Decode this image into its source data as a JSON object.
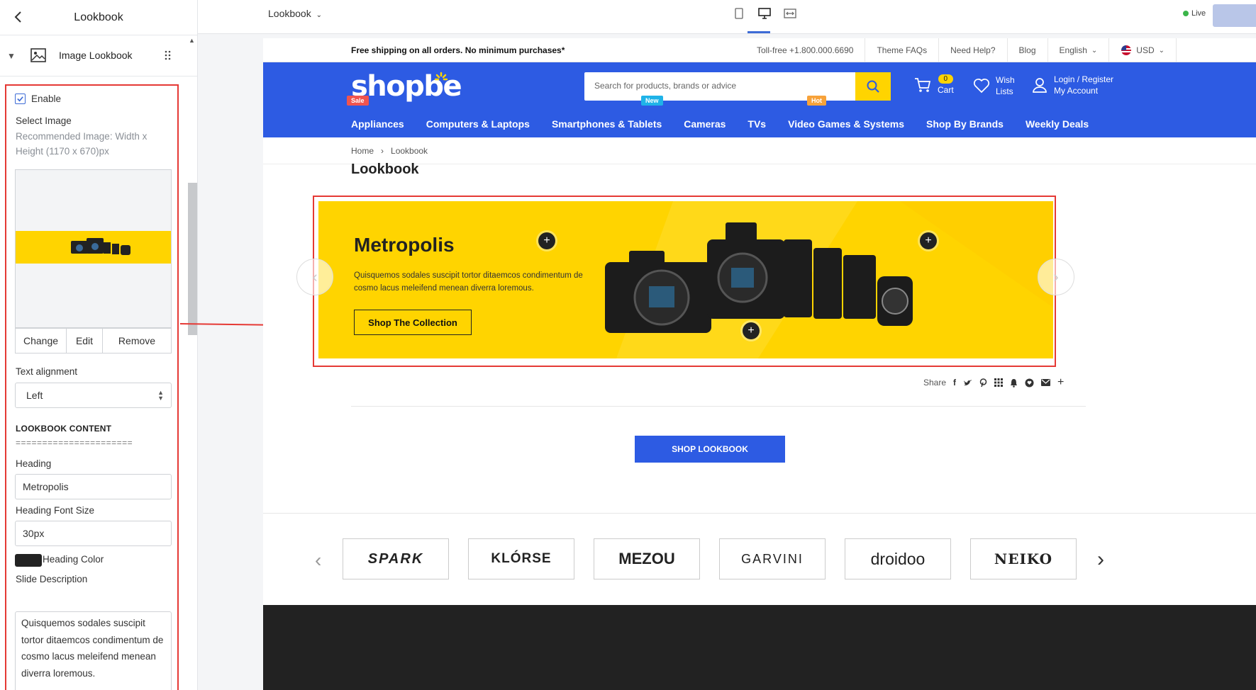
{
  "editor": {
    "title": "Lookbook",
    "block_label": "Image Lookbook",
    "enable_label": "Enable",
    "enable_checked": true,
    "select_image_label": "Select Image",
    "recommended_line1": "Recommended Image: Width x",
    "recommended_line2": "Height (1170 x 670)px",
    "image_buttons": [
      "Change",
      "Edit",
      "Remove"
    ],
    "text_alignment_label": "Text alignment",
    "text_alignment_value": "Left",
    "section_title": "LOOKBOOK CONTENT",
    "separator": "======================",
    "heading_label": "Heading",
    "heading_value": "Metropolis",
    "heading_font_size_label": "Heading Font Size",
    "heading_font_size_value": "30px",
    "heading_color_label": "Heading Color",
    "heading_color": "#222222",
    "slide_description_label": "Slide Description",
    "slide_description_value": "Quisquemos sodales suscipit tortor ditaemcos condimentum de cosmo lacus meleifend menean diverra loremous."
  },
  "topbar": {
    "page_select": "Lookbook",
    "live_label": "Live"
  },
  "store": {
    "announcement": "Free shipping on all orders. No minimum purchases*",
    "top_links": [
      "Toll-free +1.800.000.6690",
      "Theme FAQs",
      "Need Help?",
      "Blog",
      "English",
      "USD"
    ],
    "logo": "shopbe",
    "search_placeholder": "Search for products, brands or advice",
    "cart_count": "0",
    "cart_label": "Cart",
    "wish_line1": "Wish",
    "wish_line2": "Lists",
    "login_line1": "Login / Register",
    "login_line2": "My Account",
    "nav": [
      "Appliances",
      "Computers & Laptops",
      "Smartphones & Tablets",
      "Cameras",
      "TVs",
      "Video Games & Systems",
      "Shop By Brands",
      "Weekly Deals"
    ],
    "nav_tags": {
      "sale": "Sale",
      "new": "New",
      "hot": "Hot"
    },
    "breadcrumb": [
      "Home",
      "Lookbook"
    ],
    "page_title": "Lookbook",
    "banner": {
      "heading": "Metropolis",
      "description": "Quisquemos sodales suscipit tortor ditaemcos condimentum de cosmo lacus meleifend menean diverra loremous.",
      "cta": "Shop The Collection"
    },
    "share_label": "Share",
    "shop_lookbook": "SHOP LOOKBOOK",
    "brands": [
      "SPARK",
      "KLÓRSE",
      "MEZOU",
      "GARVINI",
      "droidoo",
      "NEIKO"
    ]
  },
  "colors": {
    "brand_blue": "#2d5be3",
    "accent_yellow": "#ffd400",
    "annotation_red": "#e53935",
    "tag_sale": "#f0544f",
    "tag_new": "#1fb3e8",
    "tag_hot": "#f7a23a"
  }
}
